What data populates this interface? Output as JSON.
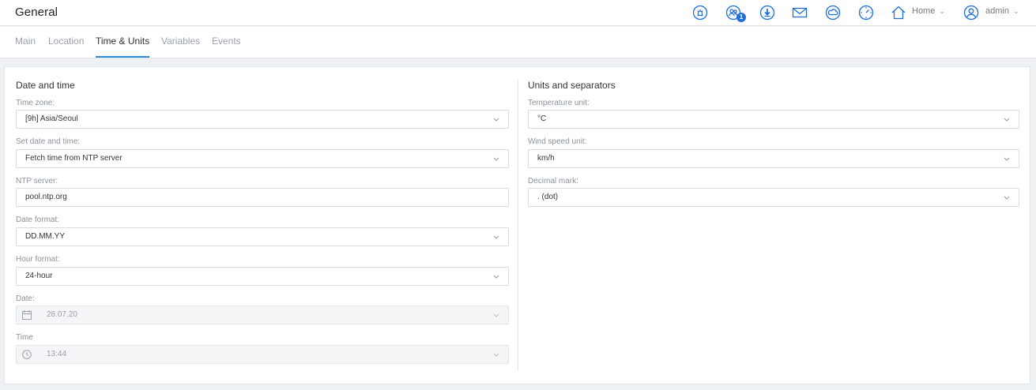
{
  "header": {
    "title": "General",
    "notification_count": "1",
    "home_label": "Home",
    "user_label": "admin"
  },
  "tabs": [
    {
      "label": "Main"
    },
    {
      "label": "Location"
    },
    {
      "label": "Time & Units"
    },
    {
      "label": "Variables"
    },
    {
      "label": "Events"
    }
  ],
  "active_tab": "Time & Units",
  "date_time": {
    "title": "Date and time",
    "timezone": {
      "label": "Time zone:",
      "value": "[9h] Asia/Seoul"
    },
    "set_mode": {
      "label": "Set date and time:",
      "value": "Fetch time from NTP server"
    },
    "ntp": {
      "label": "NTP server:",
      "value": "pool.ntp.org"
    },
    "date_format": {
      "label": "Date format:",
      "value": "DD.MM.YY"
    },
    "hour_format": {
      "label": "Hour format:",
      "value": "24-hour"
    },
    "date": {
      "label": "Date:",
      "value": "28.07.20"
    },
    "time": {
      "label": "Time",
      "value": "13:44"
    }
  },
  "units": {
    "title": "Units and separators",
    "temperature": {
      "label": "Temperature unit:",
      "value": "°C"
    },
    "wind": {
      "label": "Wind speed unit:",
      "value": "km/h"
    },
    "decimal": {
      "label": "Decimal mark:",
      "value": ". (dot)"
    }
  },
  "colors": {
    "accent": "#2b8ad9",
    "icon_blue": "#1e6fd9",
    "badge": "#1e6fd9"
  }
}
